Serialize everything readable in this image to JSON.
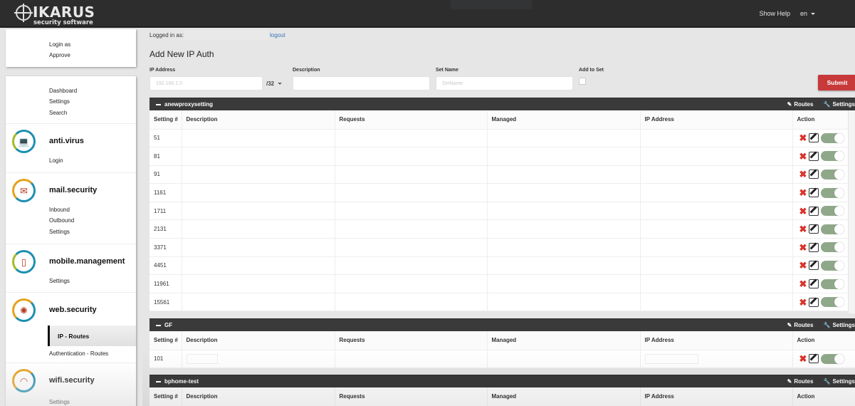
{
  "header": {
    "brand": "IKARUS",
    "tagline": "security software",
    "show_help": "Show Help",
    "language": "en"
  },
  "sidebar": {
    "top_card": [
      "Login as",
      "Approve"
    ],
    "general": [
      "Dashboard",
      "Settings",
      "Search"
    ],
    "sections": [
      {
        "title": "anti.virus",
        "icon": "laptop-icon",
        "items": [
          "Login"
        ]
      },
      {
        "title": "mail.security",
        "icon": "envelope-icon",
        "items": [
          "Inbound",
          "Outbound",
          "Settings"
        ]
      },
      {
        "title": "mobile.management",
        "icon": "mobile-devices-icon",
        "items": [
          "Settings"
        ]
      },
      {
        "title": "web.security",
        "icon": "globe-icon",
        "items": [
          "IP - Routes",
          "Authentication - Routes"
        ],
        "active": "IP - Routes"
      },
      {
        "title": "wifi.security",
        "icon": "wifi-icon",
        "items": [
          "Settings"
        ]
      }
    ]
  },
  "main": {
    "logged_in_label": "Logged in as:",
    "logged_in_user": "",
    "logout": "logout",
    "title": "Add New IP Auth",
    "form": {
      "ip_label": "IP Address",
      "ip_placeholder": "192.168.1.0",
      "cidr": "/32",
      "desc_label": "Description",
      "desc_placeholder": "",
      "set_label": "Set Name",
      "set_placeholder": "SetName",
      "add_to_set_label": "Add to Set",
      "add_to_set_checked": false,
      "submit": "Submit"
    },
    "columns": [
      "Setting #",
      "Description",
      "Requests",
      "Managed",
      "IP Address",
      "Action"
    ],
    "group_links": {
      "routes": "Routes",
      "settings": "Settings"
    },
    "groups": [
      {
        "name": "anewproxysetting",
        "rows": [
          "51",
          "81",
          "91",
          "1161",
          "1711",
          "2131",
          "3371",
          "4451",
          "11961",
          "15561"
        ],
        "toggle_on": true
      },
      {
        "name": "GF",
        "rows": [
          "101"
        ],
        "toggle_on": true
      },
      {
        "name": "bphome-test",
        "rows": [],
        "toggle_on": true
      }
    ]
  }
}
